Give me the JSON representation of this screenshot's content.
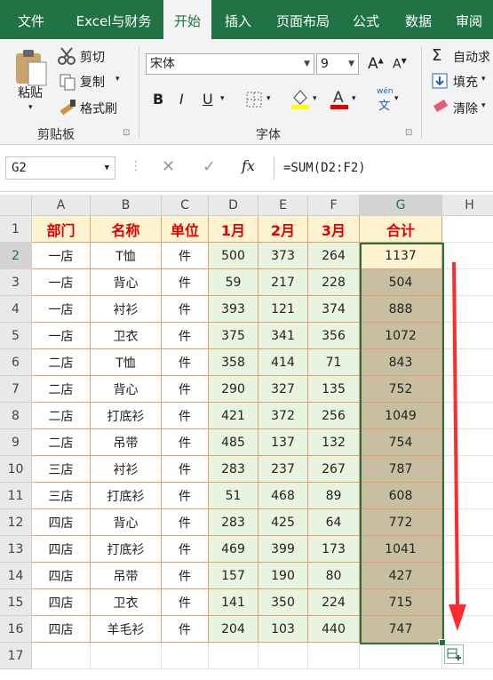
{
  "ribbon_tabs": [
    "文件",
    "Excel与财务",
    "开始",
    "插入",
    "页面布局",
    "公式",
    "数据",
    "审阅"
  ],
  "active_tab": "开始",
  "clipboard": {
    "paste": "粘贴",
    "cut": "剪切",
    "copy": "复制",
    "format_painter": "格式刷",
    "group": "剪贴板"
  },
  "font": {
    "name": "宋体",
    "size": "9",
    "bold": "B",
    "italic": "I",
    "underline": "U",
    "group": "字体",
    "wen": "wén",
    "wen_char": "文"
  },
  "editing": {
    "autosum": "自动求",
    "fill": "填充",
    "clear": "清除"
  },
  "formula_bar": {
    "name_box": "G2",
    "formula": "=SUM(D2:F2)",
    "fx": "fx"
  },
  "columns": [
    "A",
    "B",
    "C",
    "D",
    "E",
    "F",
    "G",
    "H"
  ],
  "header_row": [
    "部门",
    "名称",
    "单位",
    "1月",
    "2月",
    "3月",
    "合计"
  ],
  "rows": [
    [
      "一店",
      "T恤",
      "件",
      "500",
      "373",
      "264",
      "1137"
    ],
    [
      "一店",
      "背心",
      "件",
      "59",
      "217",
      "228",
      "504"
    ],
    [
      "一店",
      "衬衫",
      "件",
      "393",
      "121",
      "374",
      "888"
    ],
    [
      "一店",
      "卫衣",
      "件",
      "375",
      "341",
      "356",
      "1072"
    ],
    [
      "二店",
      "T恤",
      "件",
      "358",
      "414",
      "71",
      "843"
    ],
    [
      "二店",
      "背心",
      "件",
      "290",
      "327",
      "135",
      "752"
    ],
    [
      "二店",
      "打底衫",
      "件",
      "421",
      "372",
      "256",
      "1049"
    ],
    [
      "二店",
      "吊带",
      "件",
      "485",
      "137",
      "132",
      "754"
    ],
    [
      "三店",
      "衬衫",
      "件",
      "283",
      "237",
      "267",
      "787"
    ],
    [
      "三店",
      "打底衫",
      "件",
      "51",
      "468",
      "89",
      "608"
    ],
    [
      "四店",
      "背心",
      "件",
      "283",
      "425",
      "64",
      "772"
    ],
    [
      "四店",
      "打底衫",
      "件",
      "469",
      "399",
      "173",
      "1041"
    ],
    [
      "四店",
      "吊带",
      "件",
      "157",
      "190",
      "80",
      "427"
    ],
    [
      "四店",
      "卫衣",
      "件",
      "141",
      "350",
      "224",
      "715"
    ],
    [
      "四店",
      "羊毛衫",
      "件",
      "204",
      "103",
      "440",
      "747"
    ]
  ],
  "row_numbers": [
    "1",
    "2",
    "3",
    "4",
    "5",
    "6",
    "7",
    "8",
    "9",
    "10",
    "11",
    "12",
    "13",
    "14",
    "15",
    "16",
    "17"
  ],
  "colors": {
    "excel_green": "#217346",
    "header_text": "#e00000",
    "header_fill": "#fdf3d0",
    "month_fill": "#e8f4e0",
    "total_fill": "#c8bfa0",
    "arrow": "#ff2a2a"
  }
}
